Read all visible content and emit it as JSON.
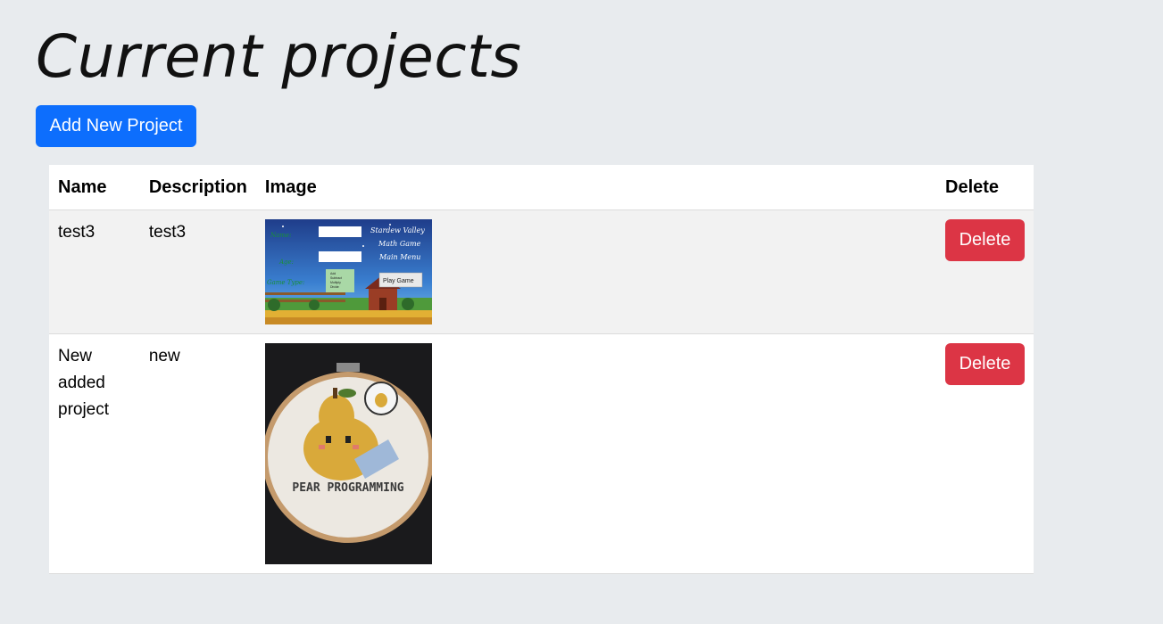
{
  "page": {
    "title": "Current projects",
    "add_button_label": "Add New Project"
  },
  "table": {
    "headers": {
      "name": "Name",
      "description": "Description",
      "image": "Image",
      "delete": "Delete"
    },
    "rows": [
      {
        "name": "test3",
        "description": "test3",
        "image": {
          "kind": "game-menu-screenshot",
          "texts": {
            "title_line1": "Stardew Valley",
            "title_line2": "Math Game",
            "title_line3": "Main Menu",
            "name_label": "Name:",
            "age_label": "Age:",
            "game_type_label": "Game Type:",
            "options": [
              "Add",
              "Subtract",
              "Multiply",
              "Divide"
            ],
            "play_button": "Play Game"
          }
        },
        "delete_label": "Delete"
      },
      {
        "name": "New added project",
        "description": "new",
        "image": {
          "kind": "cross-stitch-photo",
          "texts": {
            "caption": "PEAR PROGRAMMING"
          }
        },
        "delete_label": "Delete"
      }
    ]
  },
  "colors": {
    "background": "#e8ebee",
    "primary": "#0d6efd",
    "danger": "#dc3545"
  }
}
